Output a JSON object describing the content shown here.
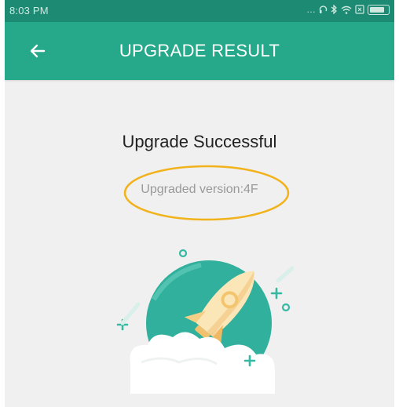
{
  "status_bar": {
    "time": "8:03 PM",
    "icons": [
      "more-dots-icon",
      "headset-icon",
      "bluetooth-icon",
      "wifi-icon",
      "sim-icon",
      "battery-icon"
    ]
  },
  "app_bar": {
    "title": "UPGRADE RESULT",
    "back_icon": "arrow-left-icon",
    "color": "#25a98a"
  },
  "result": {
    "title": "Upgrade Successful",
    "version_text": "Upgraded version:4F",
    "highlight_color": "#f2b21b"
  },
  "illustration": "rocket-launch-illustration"
}
